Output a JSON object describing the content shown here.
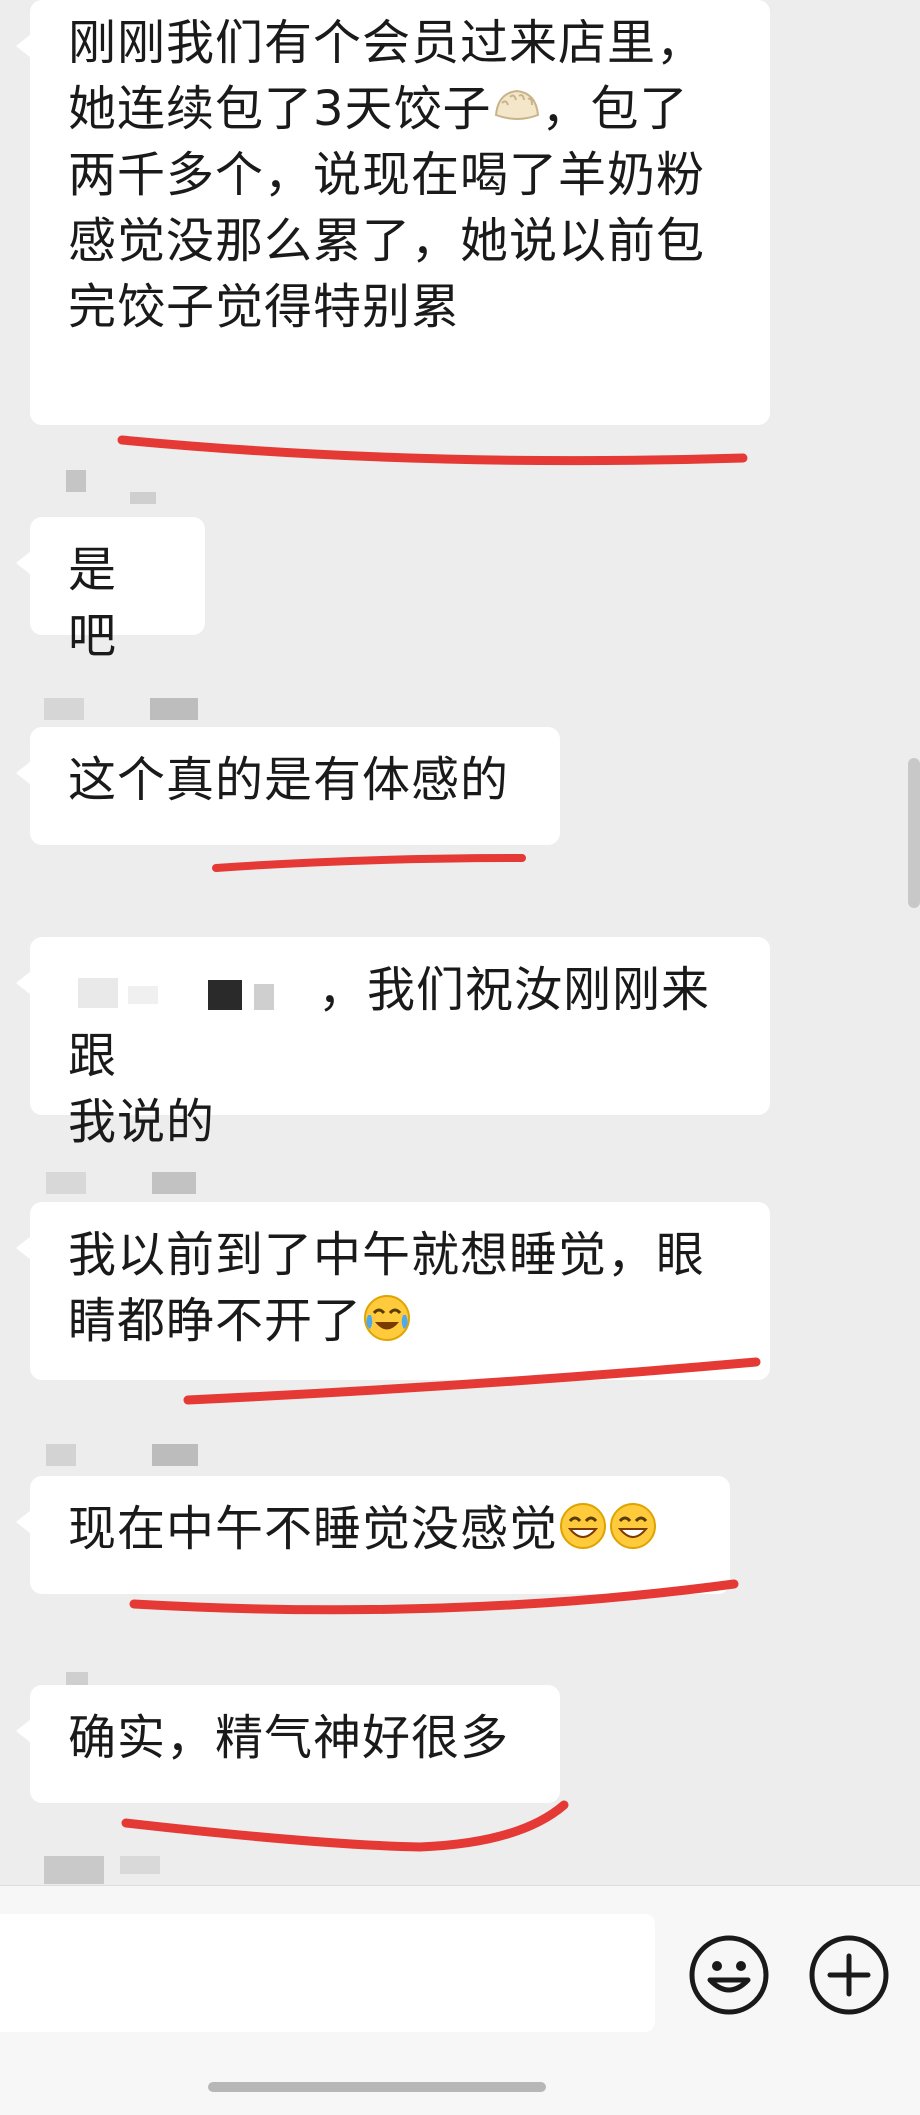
{
  "messages": [
    {
      "id": "m1",
      "text": "刚刚我们有个会员过来店里，\n她连续包了3天饺子",
      "emoji": "dumpling-emoji",
      "text_after": "，包了\n两千多个，说现在喝了羊奶粉\n感觉没那么累了，她说以前包\n完饺子觉得特别累"
    },
    {
      "id": "m2",
      "text": "是吧"
    },
    {
      "id": "m3",
      "text": "这个真的是有体感的"
    },
    {
      "id": "m4",
      "text": "，我们祝汝刚刚来跟\n我说的"
    },
    {
      "id": "m5",
      "text": "我以前到了中午就想睡觉，眼\n睛都睁不开了",
      "emoji": "crying-laughing-emoji"
    },
    {
      "id": "m6",
      "text": "现在中午不睡觉没感觉",
      "emoji": "grinning-emoji"
    },
    {
      "id": "m7",
      "text": "确实，精气神好很多"
    }
  ],
  "input": {
    "value": "",
    "placeholder": ""
  },
  "icons": {
    "emoji_button": "smiley-icon",
    "more_button": "plus-circle-icon"
  },
  "colors": {
    "underline": "#e53935",
    "bubble": "#ffffff",
    "background": "#ededed"
  }
}
